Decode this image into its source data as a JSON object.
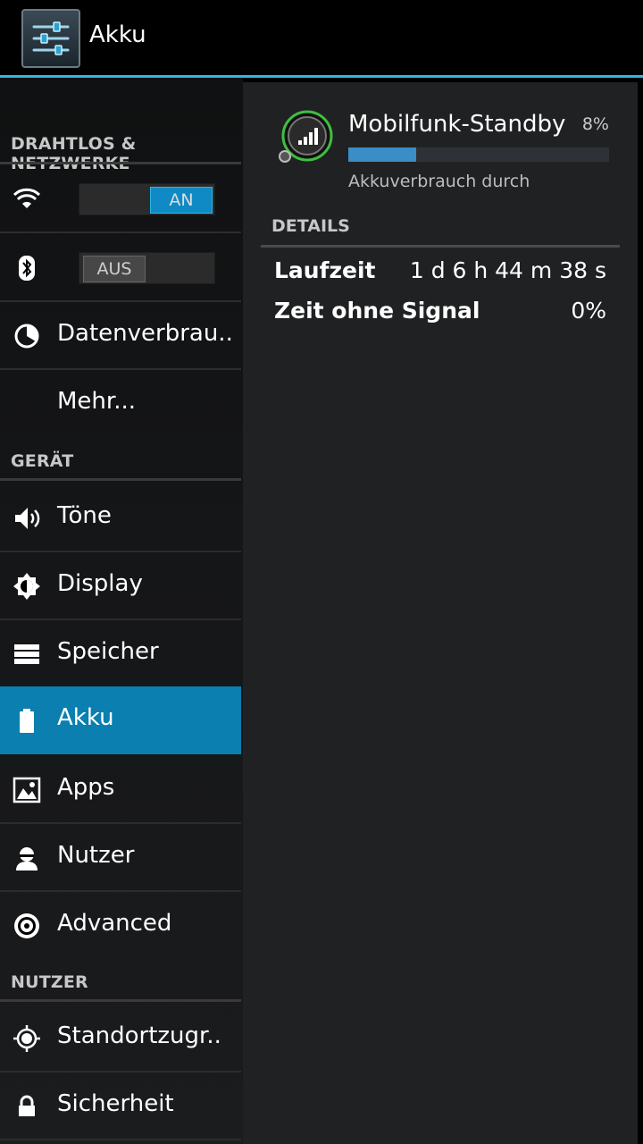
{
  "action_bar": {
    "title": "Akku",
    "app_icon": "settings-sliders-icon"
  },
  "sidebar": {
    "sections": [
      {
        "label": "DRAHTLOS & NETZWERKE"
      },
      {
        "label": "GERÄT"
      },
      {
        "label": "NUTZER"
      }
    ],
    "items": [
      {
        "icon": "wifi-icon",
        "toggle_label": "AN",
        "toggle_state": "on"
      },
      {
        "icon": "bluetooth-icon",
        "toggle_label": "AUS",
        "toggle_state": "off"
      },
      {
        "icon": "data-usage-icon",
        "label": "Datenverbrau.."
      },
      {
        "icon": "",
        "label": "Mehr..."
      },
      {
        "icon": "volume-icon",
        "label": "Töne"
      },
      {
        "icon": "brightness-icon",
        "label": "Display"
      },
      {
        "icon": "storage-icon",
        "label": "Speicher"
      },
      {
        "icon": "battery-icon",
        "label": "Akku",
        "selected": true
      },
      {
        "icon": "apps-icon",
        "label": "Apps"
      },
      {
        "icon": "user-icon",
        "label": "Nutzer"
      },
      {
        "icon": "advanced-gear-icon",
        "label": "Advanced"
      },
      {
        "icon": "location-icon",
        "label": "Standortzugr.."
      },
      {
        "icon": "lock-icon",
        "label": "Sicherheit"
      }
    ]
  },
  "detail": {
    "app_name": "Mobilfunk-Standby",
    "app_icon": "cell-signal-icon",
    "percent_label": "8%",
    "usage_fraction": 0.26,
    "subtitle": "Akkuverbrauch durch",
    "details_header": "DETAILS",
    "rows": [
      {
        "key": "Laufzeit",
        "value": "1 d 6 h 44 m 38 s"
      },
      {
        "key": "Zeit ohne Signal",
        "value": "0%"
      }
    ]
  },
  "colors": {
    "accent": "#33b5e5",
    "selected_bg": "#0a7fb0",
    "bar_fill": "#3b8dc6"
  }
}
